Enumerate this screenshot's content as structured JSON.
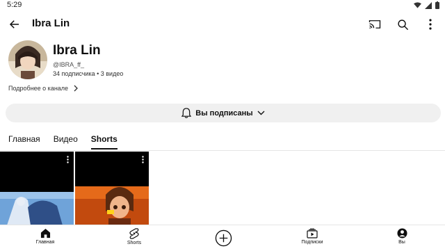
{
  "status_bar": {
    "time": "5:29"
  },
  "app_bar": {
    "title": "Ibra Lin"
  },
  "channel": {
    "name": "Ibra Lin",
    "handle": "@IBRA_ff_",
    "stats": "34 подписчика • 3 видео",
    "more_label": "Подробнее о канале"
  },
  "subscribe": {
    "label": "Вы подписаны"
  },
  "tabs": [
    {
      "label": "Главная",
      "active": false
    },
    {
      "label": "Видео",
      "active": false
    },
    {
      "label": "Shorts",
      "active": true
    }
  ],
  "bottom_nav": {
    "home": "Главная",
    "shorts": "Shorts",
    "subscriptions": "Подписки",
    "you": "Вы"
  },
  "icons": [
    "back-arrow-icon",
    "cast-icon",
    "search-icon",
    "more-vert-icon",
    "bell-icon",
    "chevron-down-icon",
    "chevron-right-icon",
    "home-icon",
    "shorts-icon",
    "add-icon",
    "subscriptions-icon",
    "account-icon"
  ]
}
